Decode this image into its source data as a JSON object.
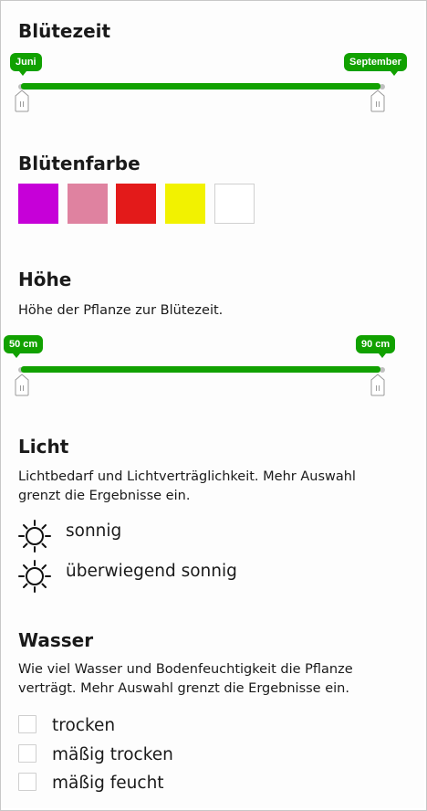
{
  "bluetezeit": {
    "title": "Blütezeit",
    "slider": {
      "min_label": "Juni",
      "max_label": "September",
      "min_value": "Juni",
      "max_value": "September"
    }
  },
  "bluetenfarbe": {
    "title": "Blütenfarbe",
    "colors": [
      "#c600d8",
      "#df82a0",
      "#e31a1a",
      "#f2f200",
      "#ffffff"
    ]
  },
  "hoehe": {
    "title": "Höhe",
    "description": "Höhe der Pflanze zur Blütezeit.",
    "slider": {
      "min_label": "50 cm",
      "max_label": "90 cm"
    }
  },
  "licht": {
    "title": "Licht",
    "description_line1": "Lichtbedarf und Lichtverträglichkeit. Mehr Auswahl",
    "description_line2": "grenzt die Ergebnisse ein.",
    "options": [
      {
        "label": "sonnig",
        "icon": "sun-icon"
      },
      {
        "label": "überwiegend sonnig",
        "icon": "sun-partial-icon"
      }
    ]
  },
  "wasser": {
    "title": "Wasser",
    "description_line1": "Wie viel Wasser und Bodenfeuchtigkeit die Pflanze",
    "description_line2": "verträgt. Mehr Auswahl grenzt die Ergebnisse ein.",
    "options": [
      {
        "label": "trocken",
        "checked": false
      },
      {
        "label": "mäßig trocken",
        "checked": false
      },
      {
        "label": "mäßig feucht",
        "checked": false
      }
    ]
  },
  "accent_color": "#11a100"
}
